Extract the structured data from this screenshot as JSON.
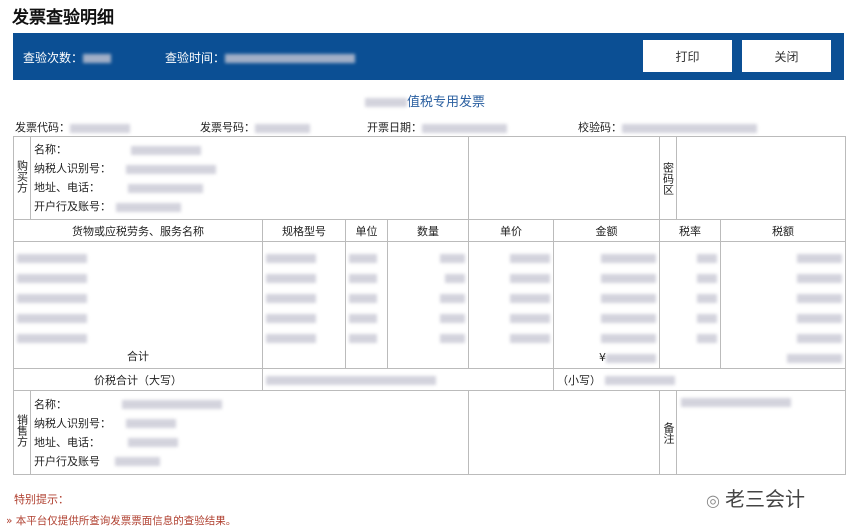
{
  "page_title": "发票查验明细",
  "bar": {
    "count_label": "查验次数：",
    "time_label": "查验时间：",
    "print": "打印",
    "close": "关闭"
  },
  "invoice_title": "值税专用发票",
  "header": {
    "code": "发票代码：",
    "number": "发票号码：",
    "date": "开票日期：",
    "check": "校验码："
  },
  "buyer": {
    "side": "购买方",
    "name": "名称：",
    "tax_id": "纳税人识别号：",
    "addr": "地址、电话：",
    "bank": "开户行及账号：",
    "cipher": "密码区"
  },
  "columns": [
    "货物或应税劳务、服务名称",
    "规格型号",
    "单位",
    "数量",
    "单价",
    "金额",
    "税率",
    "税额"
  ],
  "total_label": "合计",
  "yen": "¥",
  "sum_upper": "价税合计（大写）",
  "sum_lower": "（小写）",
  "seller": {
    "side": "销售方",
    "name": "名称：",
    "tax_id": "纳税人识别号：",
    "addr": "地址、电话：",
    "bank": "开户行及账号",
    "remark": "备注"
  },
  "notice": {
    "title": "特别提示：",
    "text": "» 本平台仅提供所查询发票票面信息的查验结果。"
  },
  "watermark": "老三会计"
}
